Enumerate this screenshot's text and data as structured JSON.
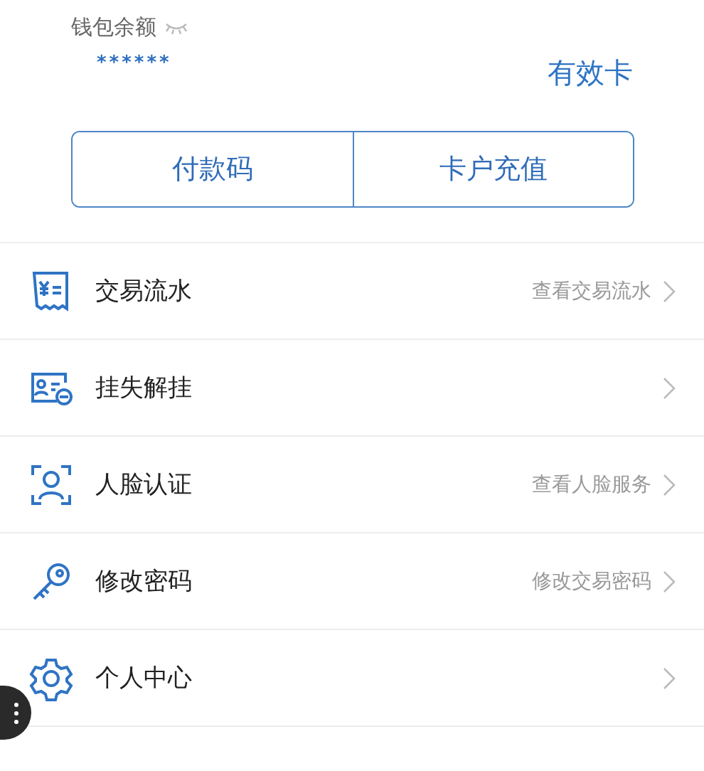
{
  "wallet": {
    "label": "钱包余额",
    "balance": "******",
    "card_status": "有效卡"
  },
  "actions": [
    "付款码",
    "卡户充值"
  ],
  "menu": [
    {
      "label": "交易流水",
      "hint": "查看交易流水"
    },
    {
      "label": "挂失解挂"
    },
    {
      "label": "人脸认证",
      "hint": "查看人脸服务"
    },
    {
      "label": "修改密码",
      "hint": "修改交易密码"
    },
    {
      "label": "个人中心"
    }
  ]
}
